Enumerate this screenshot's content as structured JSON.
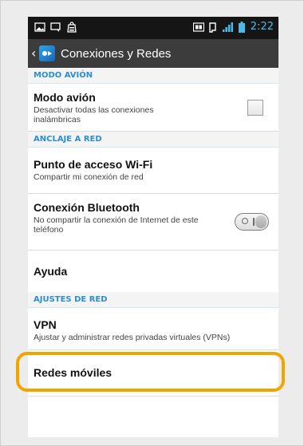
{
  "status_bar": {
    "time": "2:22",
    "left_icons": [
      "image-icon",
      "chat-icon",
      "shop-icon"
    ],
    "right_icons": [
      "screen-mirror-icon",
      "nfc-icon",
      "signal-icon",
      "battery-icon"
    ]
  },
  "action_bar": {
    "title": "Conexiones y Redes",
    "back_icon": "chevron-left-icon",
    "app_icon": "settings-connections-icon"
  },
  "sections": {
    "modo_avion_header": "MODO AVIÓN",
    "anclaje_header": "ANCLAJE A RED",
    "ajustes_header": "AJUSTES DE RED"
  },
  "items": {
    "modo_avion": {
      "title": "Modo avión",
      "subtitle": "Desactivar todas las conexiones inalámbricas",
      "checked": false
    },
    "punto_acceso": {
      "title": "Punto de acceso Wi-Fi",
      "subtitle": "Compartir mi conexión de red"
    },
    "bluetooth": {
      "title": "Conexión Bluetooth",
      "subtitle": "No compartir la conexión de Internet de este teléfono",
      "enabled": false
    },
    "ayuda": {
      "title": "Ayuda"
    },
    "vpn": {
      "title": "VPN",
      "subtitle": "Ajustar y administrar redes privadas virtuales (VPNs)"
    },
    "redes_moviles": {
      "title": "Redes móviles"
    }
  },
  "colors": {
    "accent": "#2b8fcf",
    "highlight": "#f0a500",
    "action_bar": "#3c3c3c",
    "status_bar": "#151515"
  }
}
